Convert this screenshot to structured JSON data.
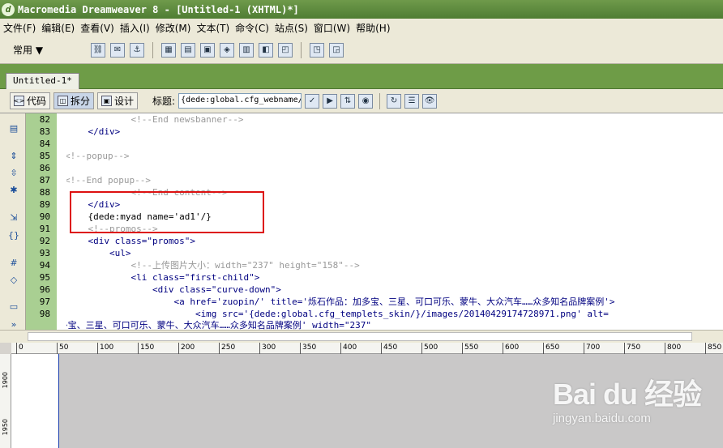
{
  "window": {
    "title": "Macromedia Dreamweaver 8 - [Untitled-1 (XHTML)*]"
  },
  "menu": [
    "文件(F)",
    "编辑(E)",
    "查看(V)",
    "插入(I)",
    "修改(M)",
    "文本(T)",
    "命令(C)",
    "站点(S)",
    "窗口(W)",
    "帮助(H)"
  ],
  "insert_bar": {
    "category": "常用"
  },
  "document_tab": {
    "label": "Untitled-1*"
  },
  "doc_toolbar": {
    "code_label": "代码",
    "split_label": "拆分",
    "design_label": "设计",
    "title_label": "标题:",
    "title_value": "{dede:global.cfg_webname/"
  },
  "code": {
    "lines": [
      {
        "n": "82",
        "t": "            <!--End newsbanner-->"
      },
      {
        "n": "83",
        "t": "    </div>"
      },
      {
        "n": "84",
        "t": ""
      },
      {
        "n": "85",
        "t": "<!--popup-->"
      },
      {
        "n": "86",
        "t": ""
      },
      {
        "n": "87",
        "t": "<!--End popup-->"
      },
      {
        "n": "88",
        "t": "            <!--End content-->"
      },
      {
        "n": "89",
        "t": "    </div>"
      },
      {
        "n": "90",
        "t": "    {dede:myad name='ad1'/}"
      },
      {
        "n": "91",
        "t": "    <!--promos-->"
      },
      {
        "n": "92",
        "t": "    <div class=\"promos\">"
      },
      {
        "n": "93",
        "t": "        <ul>"
      },
      {
        "n": "94",
        "t": "            <!--上传图片大小：width=\"237\" height=\"158\"-->"
      },
      {
        "n": "95",
        "t": "            <li class=\"first-child\">"
      },
      {
        "n": "96",
        "t": "                <div class=\"curve-down\">"
      },
      {
        "n": "97",
        "t": "                    <a href='zuopin/' title='烁石作品：加多宝、三星、可口可乐、蒙牛、大众汽车……众多知名品牌案例'>"
      },
      {
        "n": "98",
        "t": "                        <img src='{dede:global.cfg_templets_skin/}/images/20140429174728971.png' alt="
      },
      {
        "n": "",
        "t": "'烁石作品：加多宝、三星、可口可乐、蒙牛、大众汽车……众多知名品牌案例' width=\"237\""
      }
    ]
  },
  "ruler": {
    "h_labels": [
      "0",
      "50",
      "100",
      "150",
      "200",
      "250",
      "300",
      "350",
      "400",
      "450",
      "500",
      "550",
      "600",
      "650",
      "700",
      "750",
      "800",
      "850"
    ],
    "v_labels": [
      "1900",
      "1950"
    ]
  },
  "watermark": {
    "top": "Bai du 经验",
    "bottom": "jingyan.baidu.com"
  }
}
